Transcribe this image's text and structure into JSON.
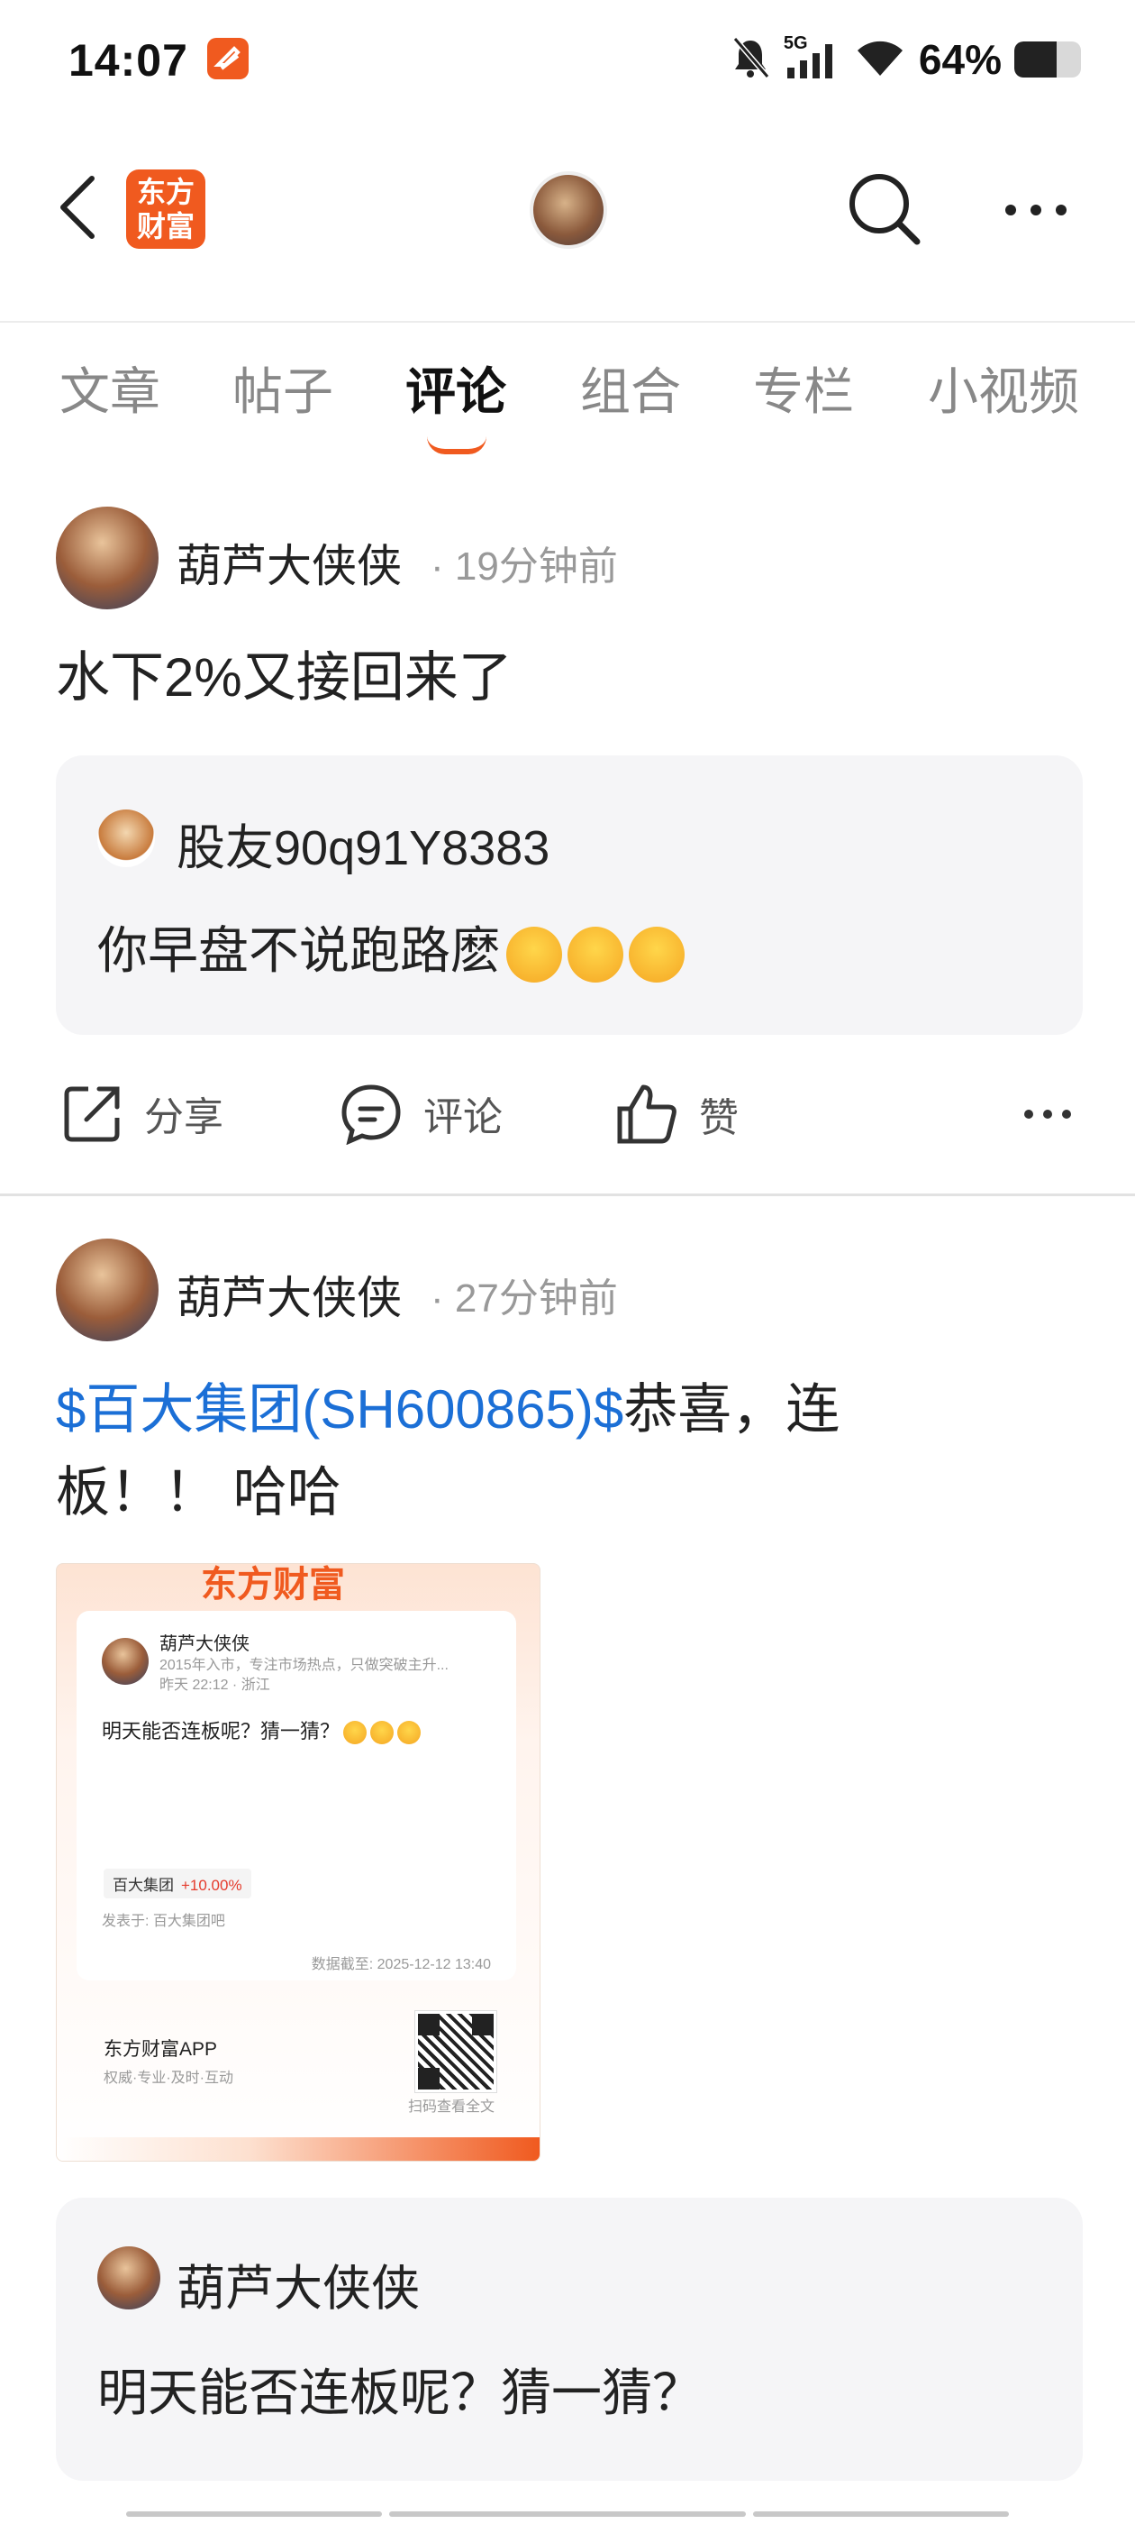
{
  "status_bar": {
    "time": "14:07",
    "network": "5G",
    "battery": "64%",
    "battery_level": 0.64
  },
  "header": {
    "brand_logo_text": "东方财富"
  },
  "tabs": [
    {
      "label": "文章",
      "active": false
    },
    {
      "label": "帖子",
      "active": false
    },
    {
      "label": "评论",
      "active": true
    },
    {
      "label": "组合",
      "active": false
    },
    {
      "label": "专栏",
      "active": false
    },
    {
      "label": "小视频",
      "active": false
    }
  ],
  "posts": [
    {
      "author": "葫芦大侠侠",
      "time": "· 19分钟前",
      "text": "水下2%又接回来了",
      "quote": {
        "author": "股友90q91Y8383",
        "text": "你早盘不说跑路麽",
        "emoji_count": 3
      },
      "actions": {
        "share": "分享",
        "comment": "评论",
        "like": "赞"
      }
    },
    {
      "author": "葫芦大侠侠",
      "time": "· 27分钟前",
      "text_link": "$百大集团(SH600865)$",
      "text_line1_rest": "恭喜，连",
      "text_line2": "板！！ 哈哈",
      "share_card": {
        "logo": "东方财富",
        "author": "葫芦大侠侠",
        "bio": "2015年入市，专注市场热点，只做突破主升...",
        "meta": "昨天 22:12 · 浙江",
        "text": "明天能否连板呢？猜一猜？",
        "stock_name": "百大集团",
        "stock_change": "+10.00%",
        "posted_in": "发表于: 百大集团吧",
        "data_time": "数据截至: 2025-12-12 13:40",
        "app_name": "东方财富APP",
        "app_tagline": "权威·专业·及时·互动",
        "qr_caption": "扫码查看全文"
      },
      "quote": {
        "author": "葫芦大侠侠",
        "text": "明天能否连板呢？猜一猜？"
      }
    }
  ],
  "colors": {
    "accent": "#f05a1f",
    "link": "#1b6fd6",
    "rise": "#e53b2c"
  }
}
